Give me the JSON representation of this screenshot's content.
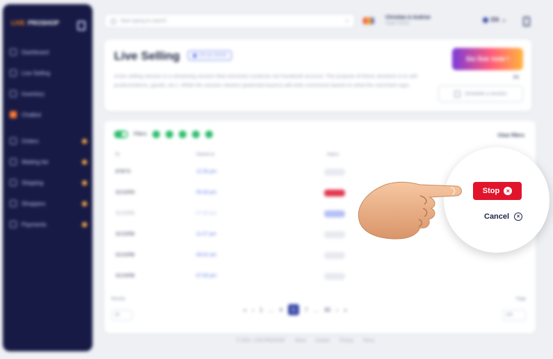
{
  "brand": {
    "live": "LIVE",
    "proshop": "PROSHOP"
  },
  "sidebar": {
    "items": [
      {
        "label": "Dashboard",
        "icon": "dashboard-icon"
      },
      {
        "label": "Live Selling",
        "icon": "live-icon"
      },
      {
        "label": "Inventory",
        "icon": "inventory-icon"
      },
      {
        "label": "Chatbot",
        "icon": "chatbot-icon"
      },
      {
        "label": "Orders",
        "icon": "orders-icon"
      },
      {
        "label": "Waiting list",
        "icon": "waiting-list-icon"
      },
      {
        "label": "Shipping",
        "icon": "shipping-icon"
      },
      {
        "label": "Shoppers",
        "icon": "shoppers-icon"
      },
      {
        "label": "Payments",
        "icon": "payments-icon"
      }
    ]
  },
  "topbar": {
    "search_placeholder": "Start typing to search",
    "user_name": "Christian & Andrew",
    "user_sub": "Super Admin",
    "language": "EN"
  },
  "live": {
    "title": "Live Selling",
    "help": "Get pro tutorial",
    "description": "A live selling session is a streaming session that merchant conducts via Facebook account. The purpose of these sessions is to sell products/items, goods, etc.). While the session viewers (potential buyers) will write comments based on what the merchant says.",
    "go_live": "Go live now !",
    "schedule": "Schedule a session",
    "count": "0/1"
  },
  "table": {
    "filters_label": "Filters",
    "clear_filters": "Clear filters",
    "headers": {
      "id": "ID",
      "time": "Started at",
      "status": "Status"
    },
    "rows": [
      {
        "id": "879/73",
        "time": "12:35 pm",
        "status": ""
      },
      {
        "id": "31/10/59",
        "time": "05:45 pm",
        "status": "LIVE"
      },
      {
        "id": "31/10/59",
        "time": "07:00 pm",
        "status": "ENDED"
      },
      {
        "id": "31/10/58",
        "time": "11:27 pm",
        "status": ""
      },
      {
        "id": "31/10/58",
        "time": "09:02 am",
        "status": ""
      },
      {
        "id": "31/10/58",
        "time": "07:00 pm",
        "status": ""
      }
    ],
    "results_label": "Results",
    "results_value": "20",
    "page_label": "Page",
    "page_value": "100",
    "pages": [
      "«",
      "‹",
      "1",
      "…",
      "4",
      "5",
      "7",
      "…",
      "80",
      "›",
      "»"
    ],
    "active_page": "5"
  },
  "footer": [
    "© 2024 - LIVE-PROSHOP",
    "About",
    "Contact",
    "Privacy",
    "Terms"
  ],
  "popup": {
    "stop_label": "Stop",
    "cancel_label": "Cancel"
  },
  "colors": {
    "sidebar": "#171a45",
    "stop": "#e2142c",
    "accent": "#5b73e8",
    "success": "#2dbd6e"
  }
}
